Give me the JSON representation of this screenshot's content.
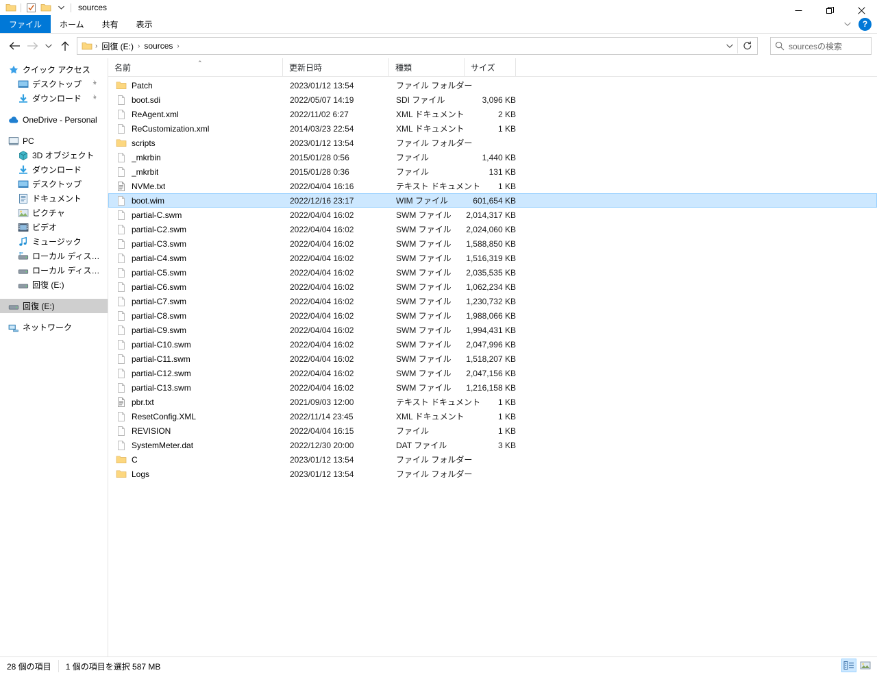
{
  "window": {
    "title": "sources",
    "quick_access_icons": [
      "folder-icon",
      "properties-check-icon",
      "new-folder-icon",
      "customize-chevron-icon"
    ],
    "controls": {
      "minimize": "minimize-icon",
      "restore": "restore-icon",
      "close": "close-icon"
    }
  },
  "ribbon": {
    "tabs": [
      {
        "label": "ファイル",
        "active": true
      },
      {
        "label": "ホーム",
        "active": false
      },
      {
        "label": "共有",
        "active": false
      },
      {
        "label": "表示",
        "active": false
      }
    ],
    "collapse_label": "⌄",
    "help_label": "?"
  },
  "address": {
    "back_icon": "back-arrow-icon",
    "forward_icon": "forward-arrow-icon",
    "recent_icon": "recent-locations-chevron-icon",
    "up_icon": "up-arrow-icon",
    "crumbs": [
      "回復 (E:)",
      "sources"
    ],
    "separator": "›",
    "refresh_icon": "refresh-icon",
    "dropdown_icon": "chevron-down-icon"
  },
  "search": {
    "placeholder": "sourcesの検索",
    "icon": "search-icon"
  },
  "sidebar": {
    "items": [
      {
        "label": "クイック アクセス",
        "icon": "star-pin-icon",
        "indent": 0,
        "selected": false,
        "pinned": false,
        "gap_before": false
      },
      {
        "label": "デスクトップ",
        "icon": "desktop-icon",
        "indent": 1,
        "selected": false,
        "pinned": true,
        "gap_before": false
      },
      {
        "label": "ダウンロード",
        "icon": "download-icon",
        "indent": 1,
        "selected": false,
        "pinned": true,
        "gap_before": false
      },
      {
        "label": "OneDrive - Personal",
        "icon": "onedrive-cloud-icon",
        "indent": 0,
        "selected": false,
        "pinned": false,
        "gap_before": true
      },
      {
        "label": "PC",
        "icon": "pc-monitor-icon",
        "indent": 0,
        "selected": false,
        "pinned": false,
        "gap_before": true
      },
      {
        "label": "3D オブジェクト",
        "icon": "3d-objects-icon",
        "indent": 1,
        "selected": false,
        "pinned": false,
        "gap_before": false
      },
      {
        "label": "ダウンロード",
        "icon": "download-icon",
        "indent": 1,
        "selected": false,
        "pinned": false,
        "gap_before": false
      },
      {
        "label": "デスクトップ",
        "icon": "desktop-icon",
        "indent": 1,
        "selected": false,
        "pinned": false,
        "gap_before": false
      },
      {
        "label": "ドキュメント",
        "icon": "documents-icon",
        "indent": 1,
        "selected": false,
        "pinned": false,
        "gap_before": false
      },
      {
        "label": "ピクチャ",
        "icon": "pictures-icon",
        "indent": 1,
        "selected": false,
        "pinned": false,
        "gap_before": false
      },
      {
        "label": "ビデオ",
        "icon": "videos-icon",
        "indent": 1,
        "selected": false,
        "pinned": false,
        "gap_before": false
      },
      {
        "label": "ミュージック",
        "icon": "music-note-icon",
        "indent": 1,
        "selected": false,
        "pinned": false,
        "gap_before": false
      },
      {
        "label": "ローカル ディスク (C:)",
        "icon": "system-drive-icon",
        "indent": 1,
        "selected": false,
        "pinned": false,
        "gap_before": false
      },
      {
        "label": "ローカル ディスク (D:)",
        "icon": "drive-icon",
        "indent": 1,
        "selected": false,
        "pinned": false,
        "gap_before": false
      },
      {
        "label": "回復 (E:)",
        "icon": "drive-icon",
        "indent": 1,
        "selected": false,
        "pinned": false,
        "gap_before": false
      },
      {
        "label": "回復 (E:)",
        "icon": "drive-icon",
        "indent": 0,
        "selected": true,
        "pinned": false,
        "gap_before": true
      },
      {
        "label": "ネットワーク",
        "icon": "network-icon",
        "indent": 0,
        "selected": false,
        "pinned": false,
        "gap_before": true
      }
    ]
  },
  "filelist": {
    "columns": [
      {
        "key": "name",
        "label": "名前",
        "sorted": "asc"
      },
      {
        "key": "date",
        "label": "更新日時",
        "sorted": ""
      },
      {
        "key": "type",
        "label": "種類",
        "sorted": ""
      },
      {
        "key": "size",
        "label": "サイズ",
        "sorted": ""
      }
    ],
    "sort_caret": "⌃",
    "rows": [
      {
        "name": "Patch",
        "date": "2023/01/12 13:54",
        "type": "ファイル フォルダー",
        "size": "",
        "icon": "folder-icon",
        "selected": false
      },
      {
        "name": "boot.sdi",
        "date": "2022/05/07 14:19",
        "type": "SDI ファイル",
        "size": "3,096 KB",
        "icon": "file-icon",
        "selected": false
      },
      {
        "name": "ReAgent.xml",
        "date": "2022/11/02 6:27",
        "type": "XML ドキュメント",
        "size": "2 KB",
        "icon": "file-icon",
        "selected": false
      },
      {
        "name": "ReCustomization.xml",
        "date": "2014/03/23 22:54",
        "type": "XML ドキュメント",
        "size": "1 KB",
        "icon": "file-icon",
        "selected": false
      },
      {
        "name": "scripts",
        "date": "2023/01/12 13:54",
        "type": "ファイル フォルダー",
        "size": "",
        "icon": "folder-icon",
        "selected": false
      },
      {
        "name": "_mkrbin",
        "date": "2015/01/28 0:56",
        "type": "ファイル",
        "size": "1,440 KB",
        "icon": "file-icon",
        "selected": false
      },
      {
        "name": "_mkrbit",
        "date": "2015/01/28 0:36",
        "type": "ファイル",
        "size": "131 KB",
        "icon": "file-icon",
        "selected": false
      },
      {
        "name": "NVMe.txt",
        "date": "2022/04/04 16:16",
        "type": "テキスト ドキュメント",
        "size": "1 KB",
        "icon": "text-file-icon",
        "selected": false
      },
      {
        "name": "boot.wim",
        "date": "2022/12/16 23:17",
        "type": "WIM ファイル",
        "size": "601,654 KB",
        "icon": "file-icon",
        "selected": true
      },
      {
        "name": "partial-C.swm",
        "date": "2022/04/04 16:02",
        "type": "SWM ファイル",
        "size": "2,014,317 KB",
        "icon": "file-icon",
        "selected": false
      },
      {
        "name": "partial-C2.swm",
        "date": "2022/04/04 16:02",
        "type": "SWM ファイル",
        "size": "2,024,060 KB",
        "icon": "file-icon",
        "selected": false
      },
      {
        "name": "partial-C3.swm",
        "date": "2022/04/04 16:02",
        "type": "SWM ファイル",
        "size": "1,588,850 KB",
        "icon": "file-icon",
        "selected": false
      },
      {
        "name": "partial-C4.swm",
        "date": "2022/04/04 16:02",
        "type": "SWM ファイル",
        "size": "1,516,319 KB",
        "icon": "file-icon",
        "selected": false
      },
      {
        "name": "partial-C5.swm",
        "date": "2022/04/04 16:02",
        "type": "SWM ファイル",
        "size": "2,035,535 KB",
        "icon": "file-icon",
        "selected": false
      },
      {
        "name": "partial-C6.swm",
        "date": "2022/04/04 16:02",
        "type": "SWM ファイル",
        "size": "1,062,234 KB",
        "icon": "file-icon",
        "selected": false
      },
      {
        "name": "partial-C7.swm",
        "date": "2022/04/04 16:02",
        "type": "SWM ファイル",
        "size": "1,230,732 KB",
        "icon": "file-icon",
        "selected": false
      },
      {
        "name": "partial-C8.swm",
        "date": "2022/04/04 16:02",
        "type": "SWM ファイル",
        "size": "1,988,066 KB",
        "icon": "file-icon",
        "selected": false
      },
      {
        "name": "partial-C9.swm",
        "date": "2022/04/04 16:02",
        "type": "SWM ファイル",
        "size": "1,994,431 KB",
        "icon": "file-icon",
        "selected": false
      },
      {
        "name": "partial-C10.swm",
        "date": "2022/04/04 16:02",
        "type": "SWM ファイル",
        "size": "2,047,996 KB",
        "icon": "file-icon",
        "selected": false
      },
      {
        "name": "partial-C11.swm",
        "date": "2022/04/04 16:02",
        "type": "SWM ファイル",
        "size": "1,518,207 KB",
        "icon": "file-icon",
        "selected": false
      },
      {
        "name": "partial-C12.swm",
        "date": "2022/04/04 16:02",
        "type": "SWM ファイル",
        "size": "2,047,156 KB",
        "icon": "file-icon",
        "selected": false
      },
      {
        "name": "partial-C13.swm",
        "date": "2022/04/04 16:02",
        "type": "SWM ファイル",
        "size": "1,216,158 KB",
        "icon": "file-icon",
        "selected": false
      },
      {
        "name": "pbr.txt",
        "date": "2021/09/03 12:00",
        "type": "テキスト ドキュメント",
        "size": "1 KB",
        "icon": "text-file-icon",
        "selected": false
      },
      {
        "name": "ResetConfig.XML",
        "date": "2022/11/14 23:45",
        "type": "XML ドキュメント",
        "size": "1 KB",
        "icon": "file-icon",
        "selected": false
      },
      {
        "name": "REVISION",
        "date": "2022/04/04 16:15",
        "type": "ファイル",
        "size": "1 KB",
        "icon": "file-icon",
        "selected": false
      },
      {
        "name": "SystemMeter.dat",
        "date": "2022/12/30 20:00",
        "type": "DAT ファイル",
        "size": "3 KB",
        "icon": "file-icon",
        "selected": false
      },
      {
        "name": "C",
        "date": "2023/01/12 13:54",
        "type": "ファイル フォルダー",
        "size": "",
        "icon": "folder-icon",
        "selected": false
      },
      {
        "name": "Logs",
        "date": "2023/01/12 13:54",
        "type": "ファイル フォルダー",
        "size": "",
        "icon": "folder-icon",
        "selected": false
      }
    ]
  },
  "statusbar": {
    "item_count": "28 個の項目",
    "selection": "1 個の項目を選択  587 MB",
    "views": [
      {
        "name": "details-view",
        "active": true
      },
      {
        "name": "large-icons-view",
        "active": false
      }
    ]
  },
  "colors": {
    "accent": "#0078d7",
    "selection_fill": "#cde8ff",
    "selection_border": "#99d1ff",
    "folder_yellow": "#fcd77f",
    "nav_selected": "#cfcfcf"
  }
}
